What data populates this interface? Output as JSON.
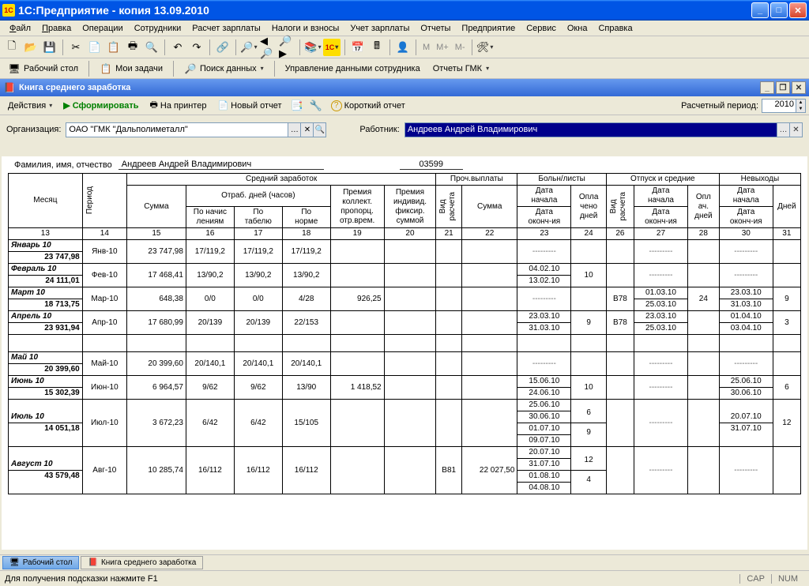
{
  "window": {
    "title": "1С:Предприятие - копия 13.09.2010"
  },
  "menu": [
    "Файл",
    "Правка",
    "Операции",
    "Сотрудники",
    "Расчет зарплаты",
    "Налоги и взносы",
    "Учет зарплаты",
    "Отчеты",
    "Предприятие",
    "Сервис",
    "Окна",
    "Справка"
  ],
  "toolbar2": {
    "desktop": "Рабочий стол",
    "tasks": "Мои задачи",
    "search": "Поиск данных",
    "emp_data": "Управление данными сотрудника",
    "gmk": "Отчеты ГМК"
  },
  "subwin": {
    "title": "Книга среднего заработка"
  },
  "subtoolbar": {
    "actions": "Действия",
    "form": "Сформировать",
    "print": "На принтер",
    "new": "Новый отчет",
    "short": "Короткий отчет",
    "period_lbl": "Расчетный период:",
    "period_val": "2010"
  },
  "form": {
    "org_lbl": "Организация:",
    "org_val": "ОАО \"ГМК \"Дальполиметалл\"",
    "worker_lbl": "Работник:",
    "worker_val": "Андреев Андрей Владимирович",
    "fio_lbl": "Фамилия, имя, отчество",
    "fio_val": "Андреев Андрей Владимирович",
    "tab_no": "03599"
  },
  "headers": {
    "month": "Месяц",
    "period_v": "Период",
    "sum": "Сумма",
    "avg": "Средний заработок",
    "worked": "Отраб. дней (часов)",
    "by_accr": "По начис\nлениям",
    "by_tab": "По\nтабелю",
    "by_norm": "По\nнорме",
    "bonus1": "Премия\nколлект.\nпропорц.\nотр.врем.",
    "bonus2": "Премия\nиндивид.\nфиксир.\nсуммой",
    "other": "Проч.выплаты",
    "calc_type": "Вид\nрасчета",
    "sum2": "Сумма",
    "sick": "Больн/листы",
    "start": "Дата\nначала",
    "end": "Дата\nоконч-ия",
    "paid": "Опла\nчено\nдней",
    "vacation": "Отпуск и средние",
    "paid2": "Опл\nач.\nдней",
    "absence": "Невыходы",
    "days": "Дней"
  },
  "colnums": [
    "13",
    "14",
    "15",
    "16",
    "17",
    "18",
    "19",
    "20",
    "21",
    "22",
    "23",
    "24",
    "26",
    "27",
    "28",
    "30",
    "31"
  ],
  "rows": [
    {
      "m": "Январь 10",
      "msum": "23 747,98",
      "per": "Янв-10",
      "sum": "23 747,98",
      "ac": "17/119,2",
      "tb": "17/119,2",
      "nm": "17/119,2",
      "b1": "",
      "b2": "",
      "vt": "",
      "s2": "",
      "sick": [
        {
          "g": "---------"
        }
      ],
      "sd": "",
      "vt2": "",
      "vac": [
        {
          "g": "---------"
        }
      ],
      "vd": "",
      "abs": [
        {
          "g": "---------"
        }
      ],
      "ad": ""
    },
    {
      "m": "Февраль 10",
      "msum": "24 111,01",
      "per": "Фев-10",
      "sum": "17 468,41",
      "ac": "13/90,2",
      "tb": "13/90,2",
      "nm": "13/90,2",
      "b1": "",
      "b2": "",
      "vt": "",
      "s2": "",
      "sick": [
        {
          "a": "04.02.10",
          "b": "13.02.10"
        }
      ],
      "sd": "10",
      "vt2": "",
      "vac": [
        {
          "g": "---------"
        }
      ],
      "vd": "",
      "abs": [
        {
          "g": "---------"
        }
      ],
      "ad": ""
    },
    {
      "m": "Март 10",
      "msum": "18 713,75",
      "per": "Мар-10",
      "sum": "648,38",
      "ac": "0/0",
      "tb": "0/0",
      "nm": "4/28",
      "b1": "926,25",
      "b2": "",
      "vt": "",
      "s2": "",
      "sick": [
        {
          "g": "---------"
        }
      ],
      "sd": "",
      "vt2": "В78",
      "vac": [
        {
          "a": "01.03.10",
          "b": "25.03.10"
        }
      ],
      "vd": "24",
      "abs": [
        {
          "a": "23.03.10",
          "b": "31.03.10"
        }
      ],
      "ad": "9"
    },
    {
      "m": "Апрель 10",
      "msum": "23 931,94",
      "per": "Апр-10",
      "sum": "17 680,99",
      "ac": "20/139",
      "tb": "20/139",
      "nm": "22/153",
      "b1": "",
      "b2": "",
      "vt": "",
      "s2": "",
      "sick": [
        {
          "a": "23.03.10",
          "b": "31.03.10"
        }
      ],
      "sd": "9",
      "vt2": "В78",
      "vac": [
        {
          "a": "23.03.10",
          "b": "25.03.10"
        }
      ],
      "vd": "",
      "abs": [
        {
          "a": "01.04.10",
          "b": "03.04.10"
        }
      ],
      "ad": "3"
    },
    {
      "blank": true
    },
    {
      "m": "Май 10",
      "msum": "20 399,60",
      "per": "Май-10",
      "sum": "20 399,60",
      "ac": "20/140,1",
      "tb": "20/140,1",
      "nm": "20/140,1",
      "b1": "",
      "b2": "",
      "vt": "",
      "s2": "",
      "sick": [
        {
          "g": "---------"
        }
      ],
      "sd": "",
      "vt2": "",
      "vac": [
        {
          "g": "---------"
        }
      ],
      "vd": "",
      "abs": [
        {
          "g": "---------"
        }
      ],
      "ad": ""
    },
    {
      "m": "Июнь 10",
      "msum": "15 302,39",
      "per": "Июн-10",
      "sum": "6 964,57",
      "ac": "9/62",
      "tb": "9/62",
      "nm": "13/90",
      "b1": "1 418,52",
      "b2": "",
      "vt": "",
      "s2": "",
      "sick": [
        {
          "a": "15.06.10",
          "b": "24.06.10"
        }
      ],
      "sd": "10",
      "vt2": "",
      "vac": [
        {
          "g": "---------"
        }
      ],
      "vd": "",
      "abs": [
        {
          "a": "25.06.10",
          "b": "30.06.10"
        }
      ],
      "ad": "6"
    },
    {
      "m": "Июль 10",
      "msum": "14 051,18",
      "per": "Июл-10",
      "sum": "3 672,23",
      "ac": "6/42",
      "tb": "6/42",
      "nm": "15/105",
      "b1": "",
      "b2": "",
      "vt": "",
      "s2": "",
      "sick": [
        {
          "a": "25.06.10",
          "b": "30.06.10"
        },
        {
          "a": "01.07.10",
          "b": "09.07.10"
        }
      ],
      "sd": [
        "6",
        "9"
      ],
      "vt2": "",
      "vac": [
        {
          "g": "---------"
        }
      ],
      "vd": "",
      "abs": [
        {
          "a": "20.07.10",
          "b": "31.07.10"
        }
      ],
      "ad": "12"
    },
    {
      "m": "Август 10",
      "msum": "43 579,48",
      "per": "Авг-10",
      "sum": "10 285,74",
      "ac": "16/112",
      "tb": "16/112",
      "nm": "16/112",
      "b1": "",
      "b2": "",
      "vt": "В81",
      "s2": "22 027,50",
      "sick": [
        {
          "a": "20.07.10",
          "b": "31.07.10"
        },
        {
          "a": "01.08.10",
          "b": "04.08.10"
        }
      ],
      "sd": [
        "12",
        "4"
      ],
      "vt2": "",
      "vac": [
        {
          "g": "---------"
        }
      ],
      "vd": "",
      "abs": [
        {
          "g": "---------"
        }
      ],
      "ad": ""
    }
  ],
  "taskbar": {
    "t1": "Рабочий стол",
    "t2": "Книга среднего заработка"
  },
  "status": {
    "hint": "Для получения подсказки нажмите F1",
    "cap": "CAP",
    "num": "NUM"
  }
}
